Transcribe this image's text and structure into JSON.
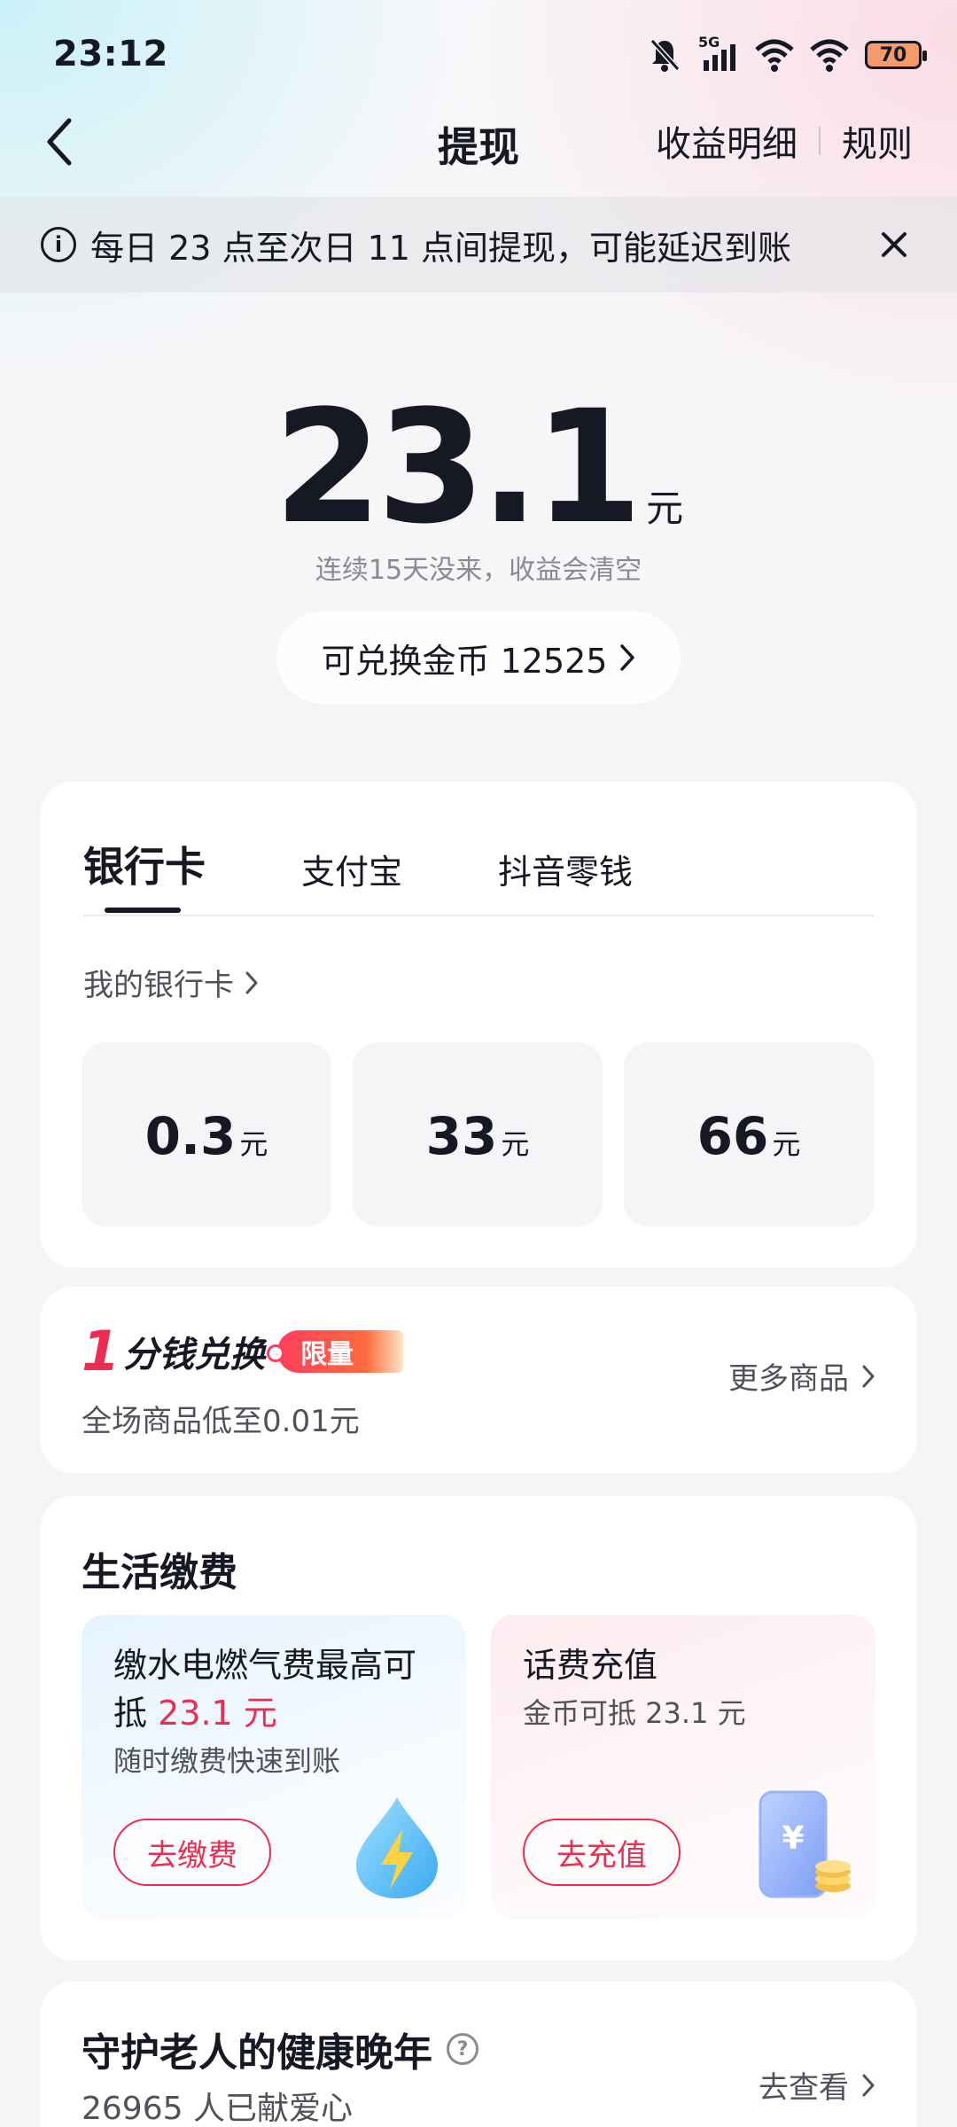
{
  "status": {
    "time": "23:12",
    "network": "5G",
    "battery": "70"
  },
  "nav": {
    "title": "提现",
    "earnings_detail": "收益明细",
    "rules": "规则"
  },
  "notice": {
    "text": "每日 23 点至次日 11 点间提现，可能延迟到账"
  },
  "balance": {
    "amount": "23.1",
    "unit": "元",
    "expire_hint": "连续15天没来，收益会清空",
    "coins_label": "可兑换金币 12525"
  },
  "withdraw": {
    "tabs": [
      {
        "label": "银行卡",
        "active": true
      },
      {
        "label": "支付宝",
        "active": false
      },
      {
        "label": "抖音零钱",
        "active": false
      }
    ],
    "my_bank_card": "我的银行卡",
    "amounts": [
      {
        "value": "0.3",
        "unit": "元"
      },
      {
        "value": "33",
        "unit": "元"
      },
      {
        "value": "66",
        "unit": "元"
      }
    ]
  },
  "promo": {
    "title_one": "1",
    "title_text": "分钱兑换",
    "tag": "限量",
    "subtitle": "全场商品低至0.01元",
    "more": "更多商品"
  },
  "life": {
    "title": "生活缴费",
    "water": {
      "title_prefix": "缴水电燃气费最高可抵",
      "title_amount": "23.1 元",
      "subtitle": "随时缴费快速到账",
      "button": "去缴费"
    },
    "phone": {
      "title": "话费充值",
      "subtitle": "金币可抵 23.1 元",
      "button": "去充值"
    }
  },
  "elder": {
    "title": "守护老人的健康晚年",
    "subtitle": "26965 人已献爱心",
    "action": "去查看"
  },
  "colors": {
    "accent_red": "#ee2c4f",
    "text_primary": "#161823",
    "text_secondary": "#505259"
  }
}
